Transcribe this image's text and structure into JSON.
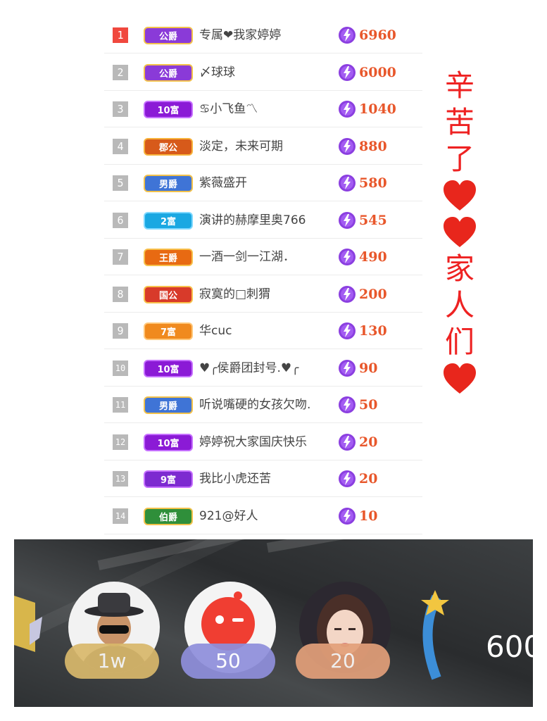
{
  "ranking": [
    {
      "rank": "1",
      "badge": "公爵",
      "badge_type": "duke",
      "name": "专属❤我家婷婷",
      "score": "6960"
    },
    {
      "rank": "2",
      "badge": "公爵",
      "badge_type": "duke",
      "name": "〆球球",
      "score": "6000"
    },
    {
      "rank": "3",
      "badge": "10富",
      "badge_type": "fu10",
      "name": "♋小飞鱼〽",
      "score": "1040"
    },
    {
      "rank": "4",
      "badge": "郡公",
      "badge_type": "dugong",
      "name": "淡定，未来可期",
      "score": "880"
    },
    {
      "rank": "5",
      "badge": "男爵",
      "badge_type": "nanjue",
      "name": "紫薇盛开",
      "score": "580"
    },
    {
      "rank": "6",
      "badge": "2富",
      "badge_type": "fu2",
      "name": "演讲的赫摩里奥766",
      "score": "545"
    },
    {
      "rank": "7",
      "badge": "王爵",
      "badge_type": "wangjue",
      "name": "一酒一剑一江湖．",
      "score": "490"
    },
    {
      "rank": "8",
      "badge": "国公",
      "badge_type": "guogong",
      "name": "寂寞的□刺猬",
      "score": "200"
    },
    {
      "rank": "9",
      "badge": "7富",
      "badge_type": "fu7",
      "name": "华cuc",
      "score": "130"
    },
    {
      "rank": "10",
      "badge": "10富",
      "badge_type": "fu10",
      "name": "♥╭侯爵团封号.♥╭",
      "score": "90"
    },
    {
      "rank": "11",
      "badge": "男爵",
      "badge_type": "nanjue",
      "name": "听说嘴硬的女孩欠吻.",
      "score": "50"
    },
    {
      "rank": "12",
      "badge": "10富",
      "badge_type": "fu10",
      "name": "婷婷祝大家国庆快乐",
      "score": "20"
    },
    {
      "rank": "13",
      "badge": "9富",
      "badge_type": "fu9",
      "name": "我比小虎还苦",
      "score": "20"
    },
    {
      "rank": "14",
      "badge": "伯爵",
      "badge_type": "bojue",
      "name": "921@好人",
      "score": "10"
    }
  ],
  "caption": {
    "chars": [
      "辛",
      "苦",
      "了",
      "heart",
      "heart",
      "家",
      "人",
      "们",
      "heart"
    ]
  },
  "live_bar": {
    "viewers": [
      {
        "tag": "1w",
        "tag_color": "#d9b86b"
      },
      {
        "tag": "50",
        "tag_color": "#8f8fdc"
      },
      {
        "tag": "20",
        "tag_color": "#e3a07a"
      }
    ],
    "partial_count": "600"
  },
  "colors": {
    "score": "#e8572b",
    "caption": "#ee2222",
    "rank_first": "#f0483e",
    "rank_other": "#b9b9b9"
  }
}
